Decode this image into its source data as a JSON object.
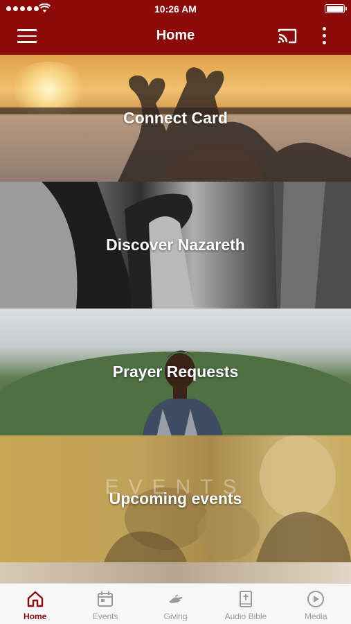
{
  "status_bar": {
    "time": "10:26 AM"
  },
  "header": {
    "title": "Home"
  },
  "tiles": [
    {
      "label": "Connect Card"
    },
    {
      "label": "Discover Nazareth"
    },
    {
      "label": "Prayer Requests"
    },
    {
      "label": "Upcoming events",
      "watermark": "EVENTS"
    }
  ],
  "tab_bar": {
    "items": [
      {
        "label": "Home",
        "icon": "home-icon",
        "active": true
      },
      {
        "label": "Events",
        "icon": "calendar-icon",
        "active": false
      },
      {
        "label": "Giving",
        "icon": "giving-hand-icon",
        "active": false
      },
      {
        "label": "Audio Bible",
        "icon": "bible-icon",
        "active": false
      },
      {
        "label": "Media",
        "icon": "play-circle-icon",
        "active": false
      }
    ]
  },
  "colors": {
    "brand": "#8c0a0a",
    "tab_inactive": "#9a9a9a",
    "events_tile": "#c6a44e"
  }
}
